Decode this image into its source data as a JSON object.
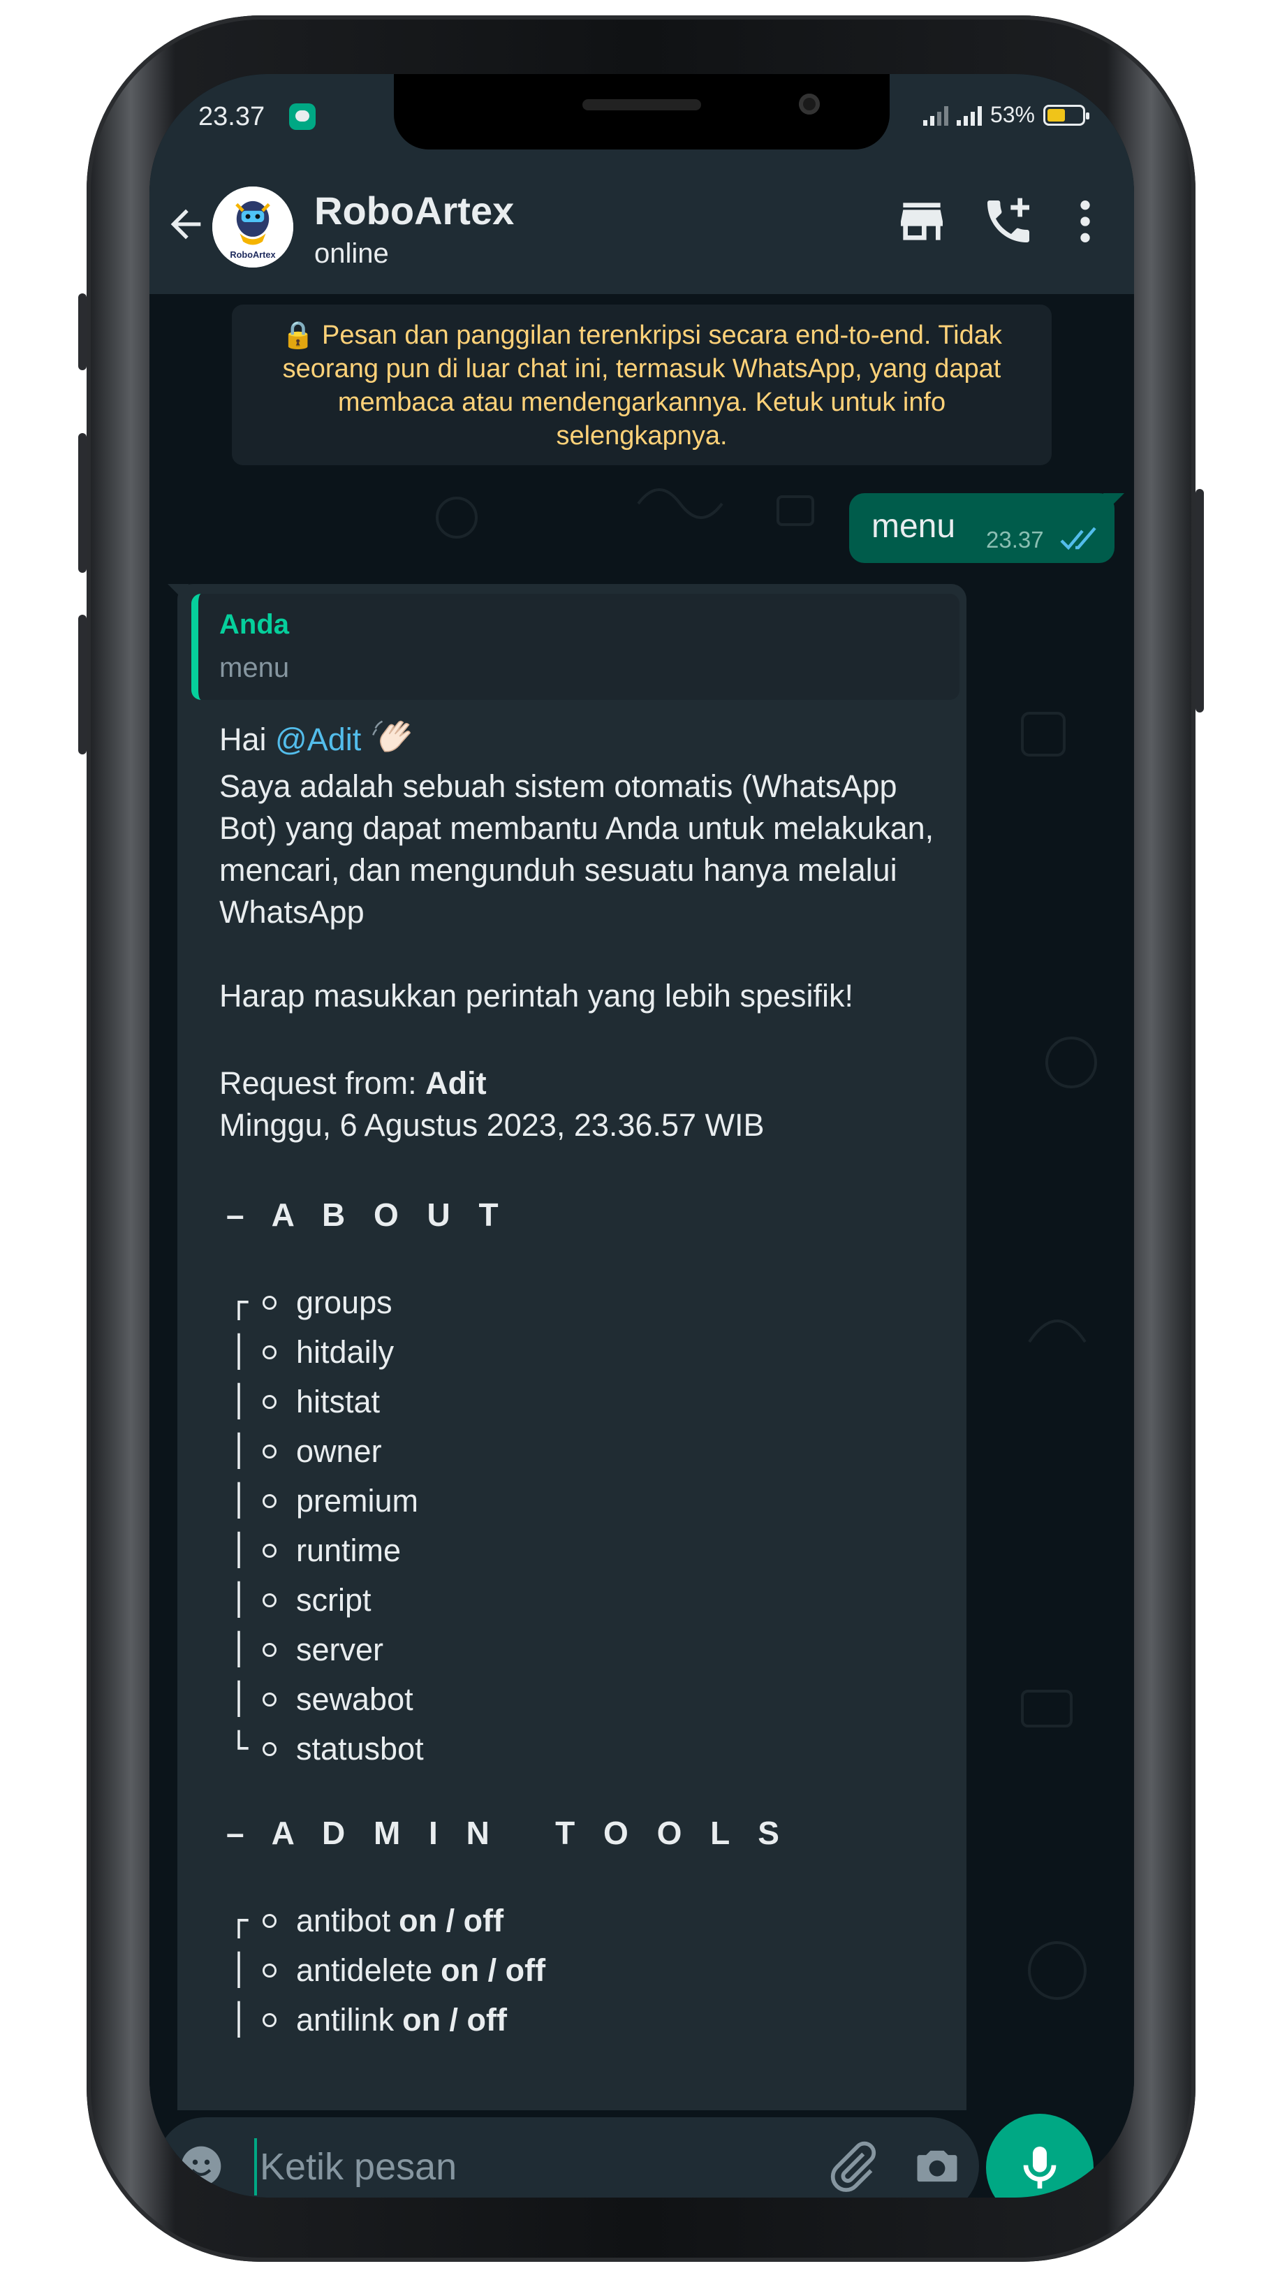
{
  "status_bar": {
    "time": "23.37",
    "battery": "53%",
    "battery_level": 0.53
  },
  "header": {
    "title": "RoboArtex",
    "status": "online",
    "avatar_text": "RoboArtex"
  },
  "chat": {
    "encryption_notice": "🔒 Pesan dan panggilan terenkripsi secara end-to-end. Tidak seorang pun di luar chat ini, termasuk WhatsApp, yang dapat membaca atau mendengarkannya. Ketuk untuk info selengkapnya.",
    "outgoing": {
      "text": "menu",
      "time": "23.37"
    },
    "incoming": {
      "quote_author": "Anda",
      "quote_text": "menu",
      "greeting": "Hai ",
      "mention": "@Adit",
      "intro": "Saya adalah sebuah sistem otomatis (WhatsApp Bot) yang dapat membantu Anda untuk melakukan, mencari, dan mengunduh sesuatu hanya melalui WhatsApp",
      "hint": "Harap masukkan perintah yang lebih spesifik!",
      "request_label": "Request from: ",
      "request_user": "Adit",
      "datetime": "Minggu, 6 Agustus 2023, 23.36.57 WIB",
      "section_about": "– A B O U T",
      "about_items": [
        "groups",
        "hitdaily",
        "hitstat",
        "owner",
        "premium",
        "runtime",
        "script",
        "server",
        "sewabot",
        "statusbot"
      ],
      "section_admin": "– A D M I N   T O O L S",
      "admin_items": [
        "antibot",
        "antidelete",
        "antilink"
      ],
      "admin_suffix": "on / off"
    }
  },
  "input": {
    "placeholder": "Ketik pesan"
  }
}
